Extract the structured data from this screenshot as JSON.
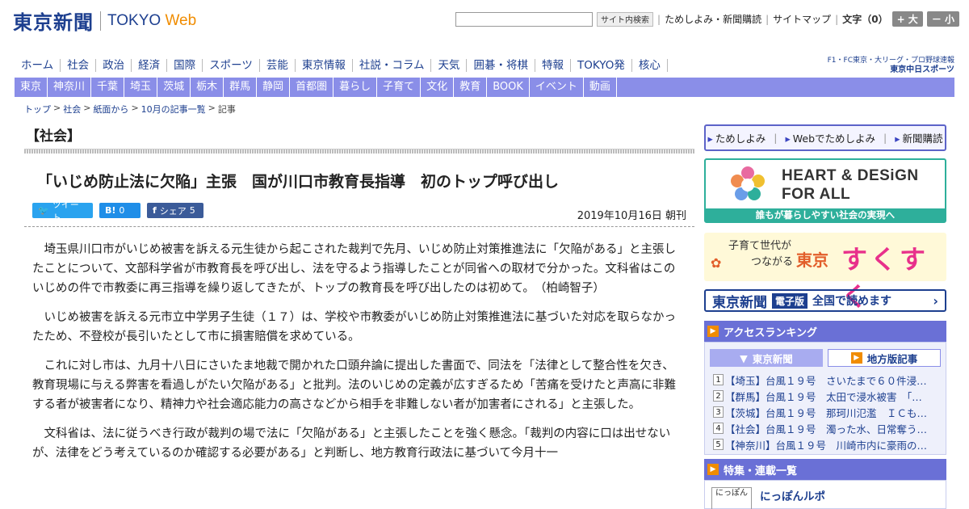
{
  "header": {
    "logo_jp": "東京新聞",
    "logo_en": "TOKYO",
    "logo_web": "Web",
    "search_placeholder": "",
    "search_button": "サイト内検索",
    "links": [
      "ためしよみ・新聞購読",
      "サイトマップ"
    ],
    "font_label": "文字（0）",
    "font_plus": "+ 大",
    "font_minus": "－ 小"
  },
  "main_nav": [
    "ホーム",
    "社会",
    "政治",
    "経済",
    "国際",
    "スポーツ",
    "芸能",
    "東京情報",
    "社説・コラム",
    "天気",
    "囲碁・将棋",
    "特報",
    "TOKYO発",
    "核心"
  ],
  "chunichi": {
    "line1": "F1・FC東京・大リーグ・プロ野球速報",
    "line2": "東京中日スポーツ"
  },
  "sub_nav": [
    "東京",
    "神奈川",
    "千葉",
    "埼玉",
    "茨城",
    "栃木",
    "群馬",
    "静岡",
    "首都圏",
    "暮らし",
    "子育て",
    "文化",
    "教育",
    "BOOK",
    "イベント",
    "動画"
  ],
  "breadcrumb": [
    "トップ",
    "社会",
    "紙面から",
    "10月の記事一覧",
    "記事"
  ],
  "article": {
    "section": "【社会】",
    "headline": "「いじめ防止法に欠陥」主張　国が川口市教育長指導　初のトップ呼び出し",
    "share": {
      "tweet": "ツイート",
      "hatena_count": "0",
      "facebook": "シェア",
      "facebook_count": "5"
    },
    "date": "2019年10月16日 朝刊",
    "paragraphs": [
      "埼玉県川口市がいじめ被害を訴える元生徒から起こされた裁判で先月、いじめ防止対策推進法に「欠陥がある」と主張したことについて、文部科学省が市教育長を呼び出し、法を守るよう指導したことが同省への取材で分かった。文科省はこのいじめの件で市教委に再三指導を繰り返してきたが、トップの教育長を呼び出したのは初めて。　（柏崎智子）",
      "いじめ被害を訴える元市立中学男子生徒（１７）は、学校や市教委がいじめ防止対策推進法に基づいた対応を取らなかったため、不登校が長引いたとして市に損害賠償を求めている。",
      "これに対し市は、九月十八日にさいたま地裁で開かれた口頭弁論に提出した書面で、同法を「法律として整合性を欠き、教育現場に与える弊害を看過しがたい欠陥がある」と批判。法のいじめの定義が広すぎるため「苦痛を受けたと声高に非難する者が被害者になり、精神力や社会適応能力の高さなどから相手を非難しない者が加害者にされる」と主張した。",
      "文科省は、法に従うべき行政が裁判の場で法に「欠陥がある」と主張したことを強く懸念。「裁判の内容に口は出せないが、法律をどう考えているのか確認する必要がある」と判断し、地方教育行政法に基づいて今月十一"
    ]
  },
  "sidebar": {
    "trial_links": [
      "ためしよみ",
      "Webでためしよみ",
      "新聞購読"
    ],
    "heart_design": {
      "title_line1": "HEART & DESiGN",
      "title_line2": "FOR ALL",
      "caption": "誰もが暮らしやすい社会の実現へ"
    },
    "susu": {
      "small_line1": "子育て世代が",
      "small_line2": "つながる",
      "tokyo": "東京",
      "big": "すくすく"
    },
    "denshi": {
      "paper": "東京新聞",
      "badge": "電子版",
      "text": "全国で読めます",
      "arrow": "›"
    },
    "ranking": {
      "title": "アクセスランキング",
      "tab_active": "東京新聞",
      "tab_inactive": "地方版記事",
      "items": [
        {
          "num": "1",
          "text": "【埼玉】台風１９号　さいたまで６０件浸…"
        },
        {
          "num": "2",
          "text": "【群馬】台風１９号　太田で浸水被害　「…"
        },
        {
          "num": "3",
          "text": "【茨城】台風１９号　那珂川氾濫　ＩＣも…"
        },
        {
          "num": "4",
          "text": "【社会】台風１９号　濁った水、日常奪う…"
        },
        {
          "num": "5",
          "text": "【神奈川】台風１９号　川崎市内に豪雨の…"
        }
      ]
    },
    "tokushu": {
      "title": "特集・連載一覧",
      "thumb": "にっぽん",
      "item": "にっぽんルポ"
    }
  },
  "colors": {
    "brand_blue": "#1d3f8f",
    "nav_purple": "#8a8ee8",
    "accent_orange": "#f08c00",
    "hd_green": "#2eaf9b"
  }
}
